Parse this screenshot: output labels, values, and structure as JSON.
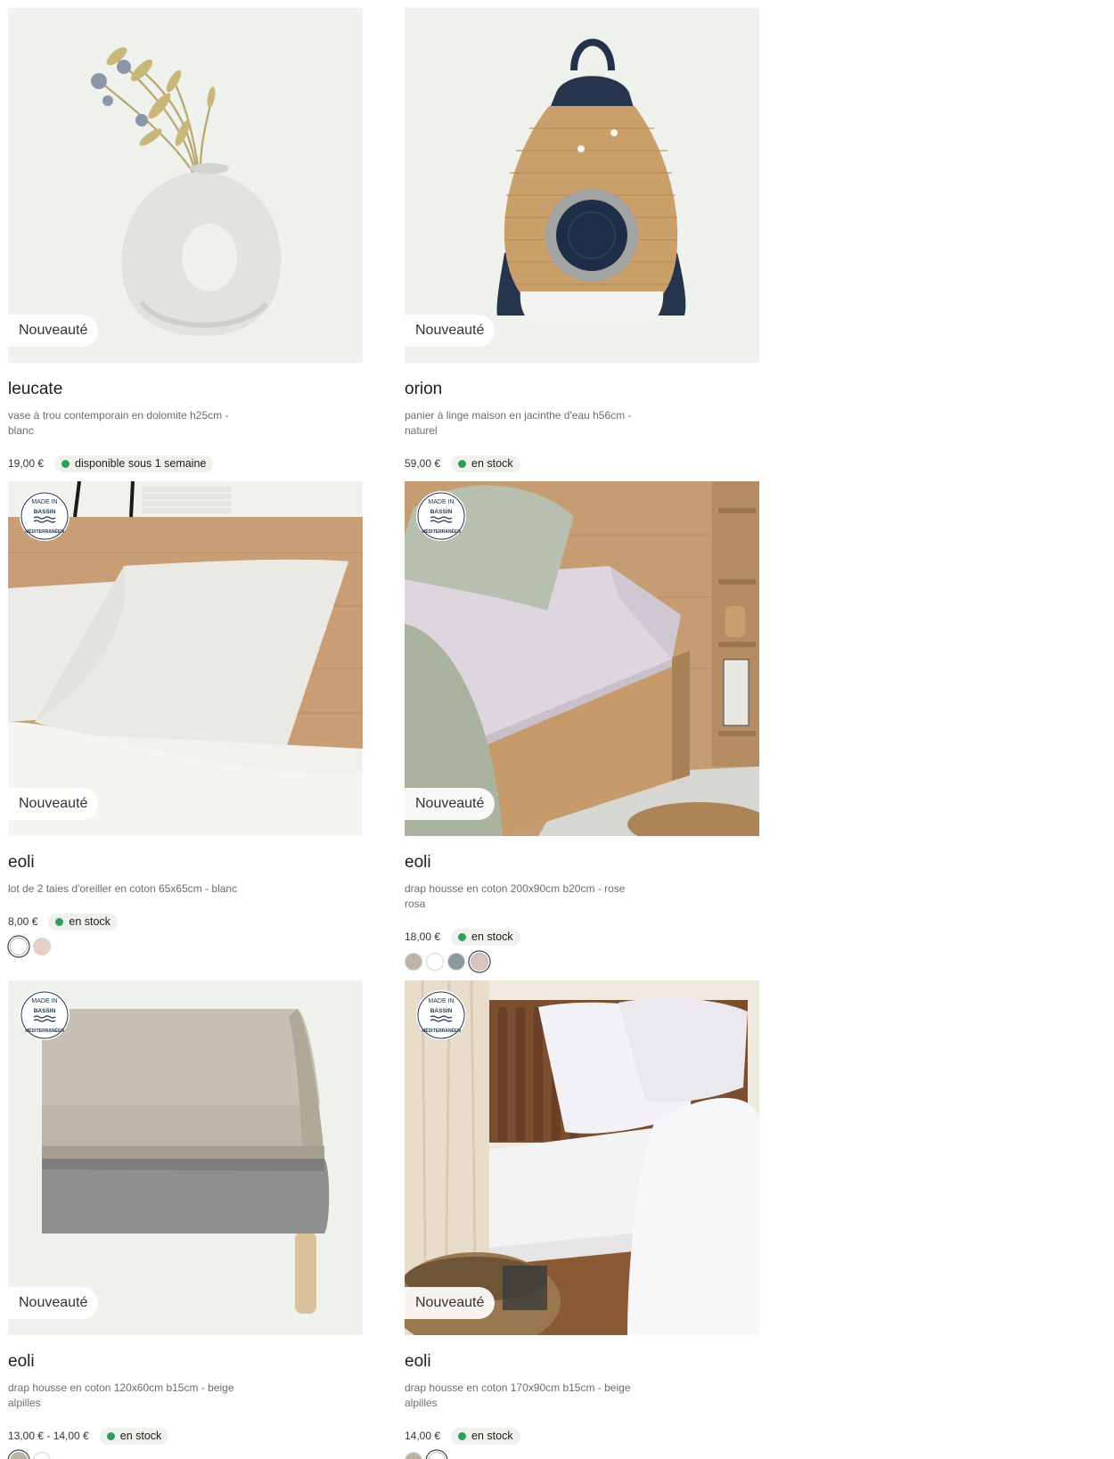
{
  "colors": {
    "stock_dot": "#2e9e5b",
    "badge_bg": "#eff1ec",
    "image_bg": "#eef1ec"
  },
  "products": [
    {
      "badge": "Nouveauté",
      "title": "leucate",
      "description": "vase à trou contemporain en dolomite h25cm - blanc",
      "price": "19,00 €",
      "stock": "disponible sous 1 semaine",
      "image_icon": "vase-photo",
      "made_in": null,
      "swatches": []
    },
    {
      "badge": "Nouveauté",
      "title": "orion",
      "description": "panier à linge maison en jacinthe d'eau h56cm - naturel",
      "price": "59,00 €",
      "stock": "en stock",
      "image_icon": "rocket-basket-photo",
      "made_in": null,
      "swatches": []
    },
    {
      "badge": "Nouveauté",
      "title": "eoli",
      "description": "lot de 2 taies d'oreiller en coton 65x65cm - blanc",
      "price": "8,00 €",
      "stock": "en stock",
      "image_icon": "pillowcase-photo",
      "made_in": [
        "MADE IN",
        "BASSIN",
        "MÉDITERRANÉEN"
      ],
      "swatches": [
        "#ffffff",
        "#e8cfc6"
      ],
      "selected_swatch": 0
    },
    {
      "badge": "Nouveauté",
      "title": "eoli",
      "description": "drap housse en coton 200x90cm b20cm - rose rosa",
      "price": "18,00 €",
      "stock": "en stock",
      "image_icon": "fitted-sheet-bed-photo",
      "made_in": [
        "MADE IN",
        "BASSIN",
        "MÉDITERRANÉEN"
      ],
      "swatches": [
        "#b9b4a6",
        "#ffffff",
        "#8a9a9b",
        "#dcc2bd"
      ],
      "selected_swatch": 3
    },
    {
      "badge": "Nouveauté",
      "title": "eoli",
      "description": "drap housse en coton 120x60cm b15cm - beige alpilles",
      "price": "13,00 € - 14,00 €",
      "stock": "en stock",
      "image_icon": "fitted-sheet-mattress-photo",
      "made_in": [
        "MADE IN",
        "BASSIN",
        "MÉDITERRANÉEN"
      ],
      "swatches": [
        "#b9b4a6",
        "#ffffff"
      ],
      "selected_swatch": 0
    },
    {
      "badge": "Nouveauté",
      "title": "eoli",
      "description": "drap housse en coton 170x90cm b15cm - beige alpilles",
      "price": "14,00 €",
      "stock": "en stock",
      "image_icon": "bedroom-photo",
      "made_in": [
        "MADE IN",
        "BASSIN",
        "MÉDITERRANÉEN"
      ],
      "swatches": [
        "#b9b4a6",
        "#ffffff"
      ],
      "selected_swatch": 1
    }
  ]
}
